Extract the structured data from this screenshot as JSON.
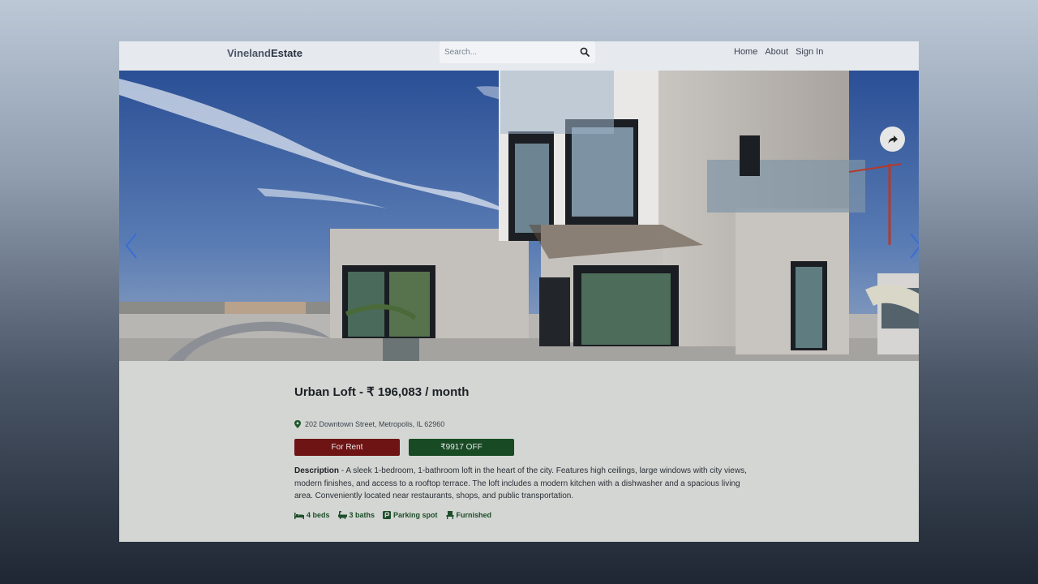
{
  "navbar": {
    "brand_part1": "Vineland",
    "brand_part2": "Estate",
    "search_placeholder": "Search...",
    "links": [
      "Home",
      "About",
      "Sign In"
    ]
  },
  "listing": {
    "title": "Urban Loft - ₹ 196,083 / month",
    "address": "202 Downtown Street, Metropolis, IL 62960",
    "status_badge": "For Rent",
    "discount_badge": "₹9917 OFF",
    "description_label": "Description",
    "description_text": " - A sleek 1-bedroom, 1-bathroom loft in the heart of the city. Features high ceilings, large windows with city views, modern finishes, and access to a rooftop terrace. The loft includes a modern kitchen with a dishwasher and a spacious living area. Conveniently located near restaurants, shops, and public transportation.",
    "features": {
      "beds": "4 beds",
      "baths": "3 baths",
      "parking": "Parking spot",
      "furnished": "Furnished"
    }
  },
  "colors": {
    "rent_badge": "#6e1414",
    "discount_badge": "#184a24",
    "feature_text": "#1d4d2a"
  }
}
